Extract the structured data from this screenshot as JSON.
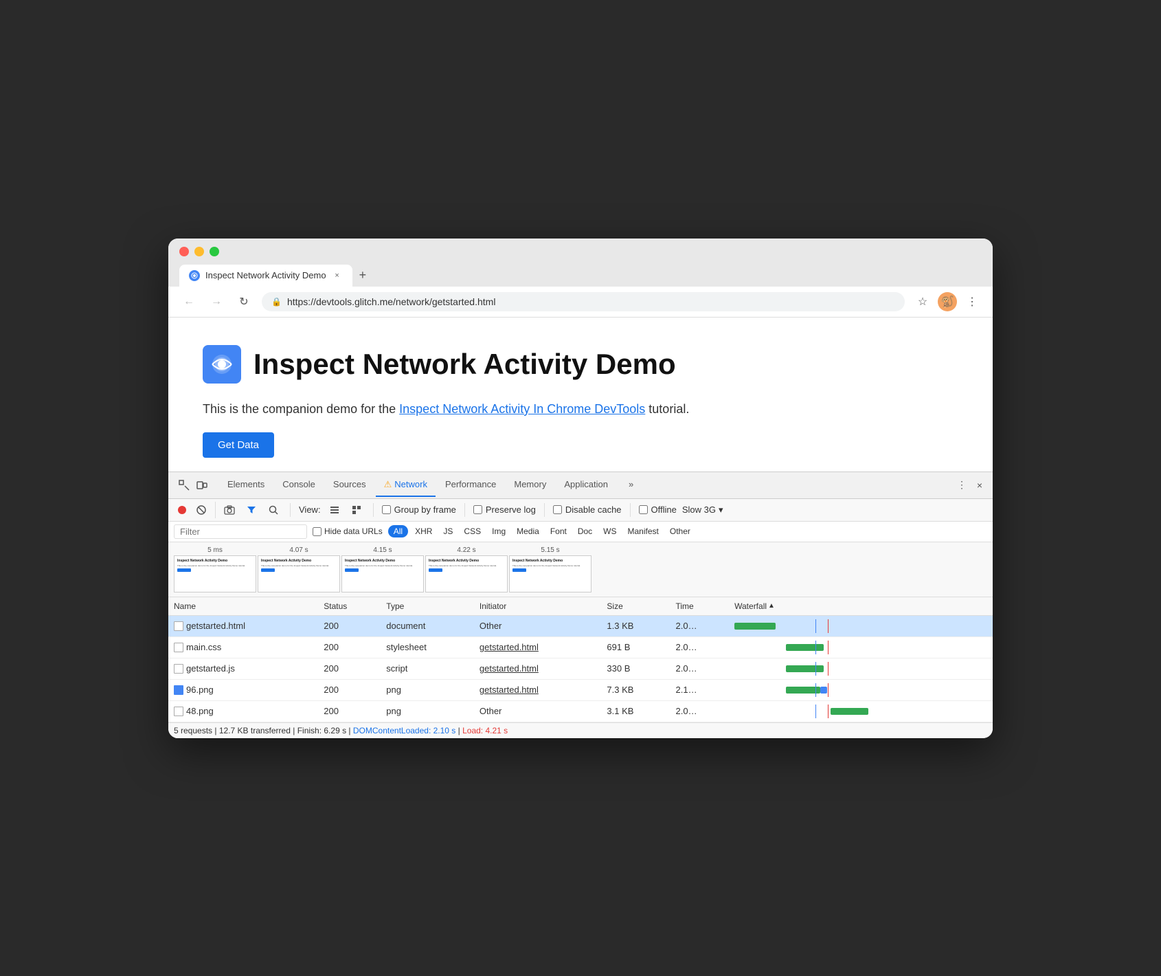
{
  "browser": {
    "tab_title": "Inspect Network Activity Demo",
    "tab_close": "×",
    "tab_new": "+",
    "url": "https://devtools.glitch.me/network/getstarted.html",
    "nav": {
      "back": "←",
      "forward": "→",
      "refresh": "↻",
      "lock_icon": "🔒",
      "star_icon": "☆",
      "avatar": "🐒",
      "menu": "⋮"
    }
  },
  "page": {
    "title": "Inspect Network Activity Demo",
    "description_before": "This is the companion demo for the ",
    "link_text": "Inspect Network Activity In Chrome DevTools",
    "description_after": " tutorial.",
    "button_label": "Get Data",
    "logo_symbol": "⊙"
  },
  "devtools": {
    "tabs": [
      {
        "label": "Elements",
        "active": false
      },
      {
        "label": "Console",
        "active": false
      },
      {
        "label": "Sources",
        "active": false
      },
      {
        "label": "⚠ Network",
        "active": true
      },
      {
        "label": "Performance",
        "active": false
      },
      {
        "label": "Memory",
        "active": false
      },
      {
        "label": "Application",
        "active": false
      },
      {
        "label": "»",
        "active": false
      }
    ],
    "toolbar": {
      "record_title": "Record network log",
      "clear_title": "Clear",
      "camera_title": "Capture screenshots",
      "filter_title": "Filter",
      "search_title": "Search",
      "view_label": "View:",
      "group_by_frame": "Group by frame",
      "preserve_log": "Preserve log",
      "disable_cache": "Disable cache",
      "offline": "Offline",
      "throttle": "Slow 3G",
      "throttle_arrow": "▾"
    },
    "filter_bar": {
      "placeholder": "Filter",
      "hide_data_urls": "Hide data URLs",
      "chips": [
        "All",
        "XHR",
        "JS",
        "CSS",
        "Img",
        "Media",
        "Font",
        "Doc",
        "WS",
        "Manifest",
        "Other"
      ]
    },
    "timeline": {
      "timestamps": [
        "5 ms",
        "4.07 s",
        "4.15 s",
        "4.22 s",
        "5.15 s"
      ]
    },
    "table": {
      "headers": [
        "Name",
        "Status",
        "Type",
        "Initiator",
        "Size",
        "Time",
        "Waterfall"
      ],
      "rows": [
        {
          "name": "getstarted.html",
          "status": "200",
          "type": "document",
          "initiator": "Other",
          "initiator_link": false,
          "size": "1.3 KB",
          "time": "2.0…",
          "icon_type": "doc",
          "selected": true,
          "wf_start": 0,
          "wf_width": 60,
          "wf_color": "green"
        },
        {
          "name": "main.css",
          "status": "200",
          "type": "stylesheet",
          "initiator": "getstarted.html",
          "initiator_link": true,
          "size": "691 B",
          "time": "2.0…",
          "icon_type": "doc",
          "selected": false,
          "wf_start": 75,
          "wf_width": 55,
          "wf_color": "green"
        },
        {
          "name": "getstarted.js",
          "status": "200",
          "type": "script",
          "initiator": "getstarted.html",
          "initiator_link": true,
          "size": "330 B",
          "time": "2.0…",
          "icon_type": "doc",
          "selected": false,
          "wf_start": 75,
          "wf_width": 55,
          "wf_color": "green"
        },
        {
          "name": "96.png",
          "status": "200",
          "type": "png",
          "initiator": "getstarted.html",
          "initiator_link": true,
          "size": "7.3 KB",
          "time": "2.1…",
          "icon_type": "png",
          "selected": false,
          "wf_start": 75,
          "wf_width": 50,
          "wf_extra_start": 125,
          "wf_extra_width": 10,
          "wf_extra_color": "blue",
          "wf_color": "green"
        },
        {
          "name": "48.png",
          "status": "200",
          "type": "png",
          "initiator": "Other",
          "initiator_link": false,
          "size": "3.1 KB",
          "time": "2.0…",
          "icon_type": "doc",
          "selected": false,
          "wf_start": 140,
          "wf_width": 55,
          "wf_color": "green"
        }
      ]
    },
    "status_bar": {
      "requests": "5 requests",
      "transferred": "12.7 KB transferred",
      "finish": "Finish: 6.29 s",
      "dom_content_loaded": "DOMContentLoaded: 2.10 s",
      "load": "Load: 4.21 s"
    },
    "close_icon": "×",
    "more_icon": "⋮"
  }
}
